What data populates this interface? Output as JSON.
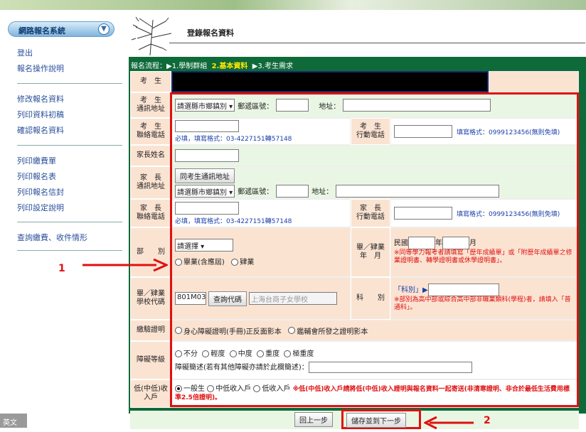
{
  "sidebar": {
    "system_label": "網路報名系統",
    "links": [
      "登出",
      "報名操作說明",
      "修改報名資料",
      "列印資料初稿",
      "確認報名資料",
      "列印繳費單",
      "列印報名表",
      "列印報名信封",
      "列印設定說明",
      "查詢繳費、收件情形"
    ],
    "taskbar": "英文"
  },
  "header": {
    "title": "登錄報名資料"
  },
  "flow": {
    "prefix": "報名流程：",
    "step1": "▶1.學制群組",
    "step2": "2.基本資料",
    "step3": "▶3.考生需求"
  },
  "form": {
    "examinee_label": "考　生",
    "addr_label": "考　生\n通訊地址",
    "county_select": "請選縣市鄉鎮別",
    "zip_label": "郵遞區號：",
    "addr_field_label": "地址：",
    "phone_label": "考　生\n聯絡電話",
    "phone_hint": "必填，填寫格式：03-4227151轉57148",
    "mobile_label": "考　生\n行動電話",
    "mobile_hint": "填寫格式：0999123456(無則免填)",
    "parent_name_label": "家長姓名",
    "parent_addr_label": "家　長\n通訊地址",
    "same_addr_btn": "同考生通訊地址",
    "parent_county_select": "請選縣市鄉鎮別",
    "parent_zip_label": "郵遞區號：",
    "parent_addr_field_label": "地址：",
    "parent_phone_label": "家　長\n聯絡電話",
    "parent_phone_hint": "必填，填寫格式：03-4227151轉57148",
    "parent_mobile_label": "家　長\n行動電話",
    "parent_mobile_hint": "填寫格式：0999123456(無則免填)",
    "dept_label": "部　　別",
    "dept_select": "請選擇",
    "dept_opt1": "畢業(含應屆)",
    "dept_opt2": "肄業",
    "grad_label": "畢／肄業\n年　月",
    "grad_prefix": "民國",
    "grad_year": "年",
    "grad_month": "月",
    "grad_note": "※同等學力報考者請填寫「歷年成績單」或「附歷年成績單之修業證明書、轉學證明書或休學證明書」。",
    "school_label": "畢／肄業\n學校代碼",
    "school_code": "801M03",
    "school_btn": "查詢代碼",
    "school_name": "上海台商子女學校",
    "subject_label": "科　　別",
    "subject_link": "「科別」▶",
    "subject_note": "※部別為高中部或綜合高中部非職業類科(學程)者，請填入「普通科」。",
    "proof_label": "繳驗證明",
    "proof_opt1": "身心障礙證明(手冊)正反面影本",
    "proof_opt2": "鑑輔會所發之證明影本",
    "disab_label": "障礙等級",
    "disab_opts": [
      "不分",
      "輕度",
      "中度",
      "重度",
      "極重度"
    ],
    "disab_desc": "障礙簡述(若有其他障礙亦請於此欄簡述)：",
    "income_label": "低(中低)收\n入戶",
    "income_opts": [
      "一般生",
      "中低收入戶",
      "低收入戶"
    ],
    "income_note": "※低(中低)收入戶請將低(中低)收入證明與報名資料一起寄送(非清寒證明、非合於最低生活費用標準2.5倍證明)。"
  },
  "buttons": {
    "back": "回上一步",
    "next": "儲存並到下一步"
  },
  "annotations": {
    "one": "1",
    "two": "2"
  }
}
